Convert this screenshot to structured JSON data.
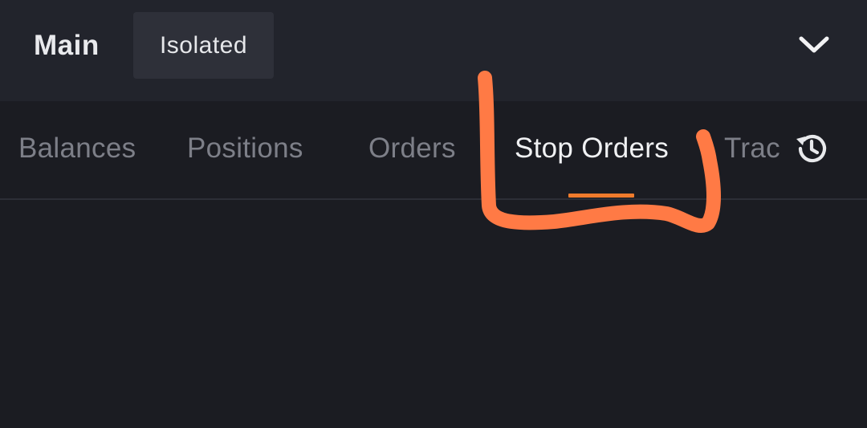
{
  "account_bar": {
    "main_label": "Main",
    "isolated_label": "Isolated",
    "dropdown_icon": "chevron-down-icon"
  },
  "tabs": [
    {
      "label": "Balances",
      "active": false
    },
    {
      "label": "Positions",
      "active": false
    },
    {
      "label": "Orders",
      "active": false
    },
    {
      "label": "Stop Orders",
      "active": true
    },
    {
      "label": "Trac",
      "active": false
    }
  ],
  "history_icon": "history-icon",
  "colors": {
    "accent": "#f07b2c",
    "annotation": "#ff7a45",
    "background": "#1b1c22",
    "header": "#22242c"
  }
}
